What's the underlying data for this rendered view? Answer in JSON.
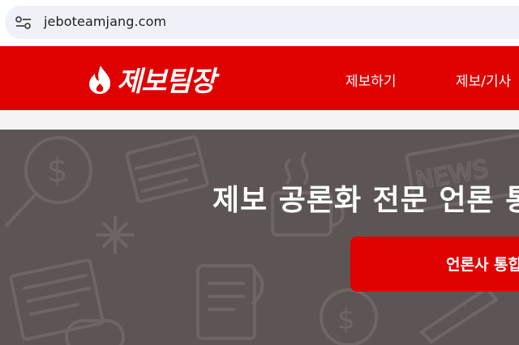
{
  "browser": {
    "url": "jeboteamjang.com",
    "site_info_icon": "tune-icon"
  },
  "header": {
    "logo_text": "제보팀장",
    "logo_icon": "flame-icon",
    "nav": [
      {
        "label": "제보하기"
      },
      {
        "label": "제보/기사"
      }
    ]
  },
  "hero": {
    "title": "제보 공론화 전문 언론 통",
    "button_label": "언론사 통합"
  },
  "colors": {
    "brand_red": "#e00000",
    "hero_bg": "#5d5554"
  }
}
